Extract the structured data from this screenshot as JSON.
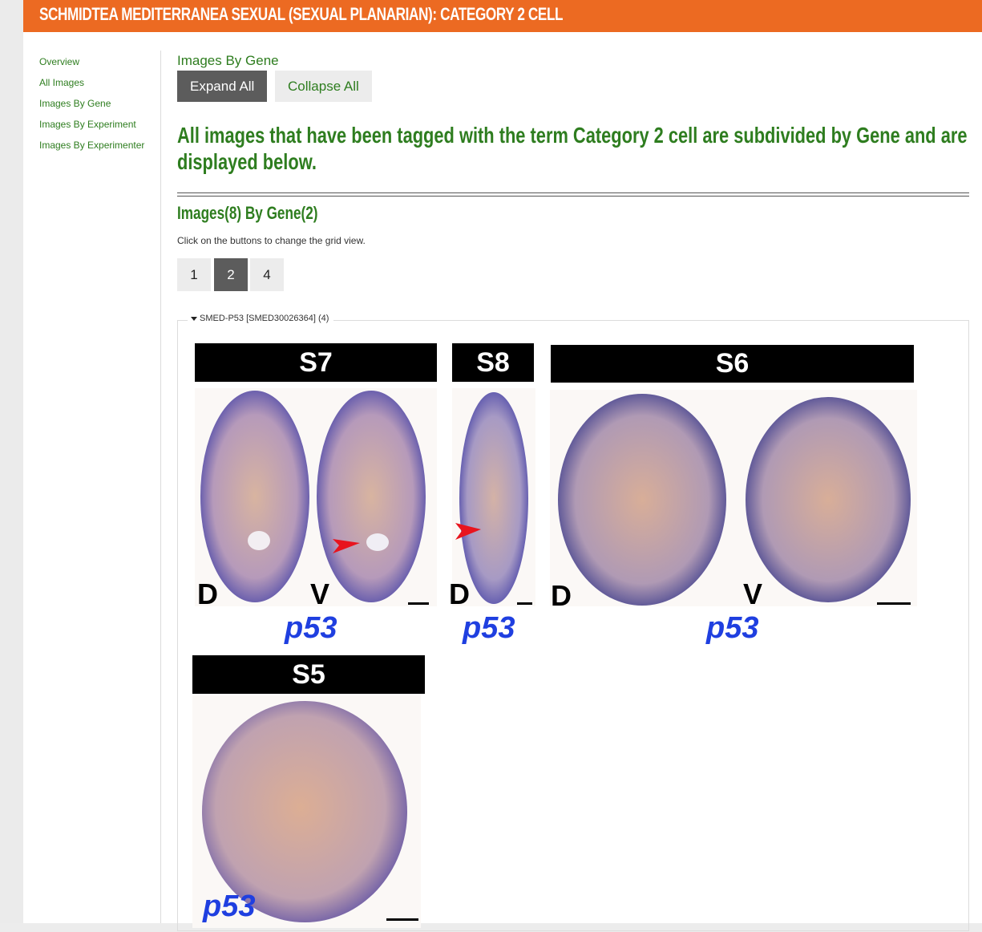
{
  "header": {
    "title": "SCHMIDTEA MEDITERRANEA SEXUAL (SEXUAL PLANARIAN): CATEGORY 2 CELL"
  },
  "sidebar": {
    "items": [
      {
        "label": "Overview"
      },
      {
        "label": "All Images"
      },
      {
        "label": "Images By Gene"
      },
      {
        "label": "Images By Experiment"
      },
      {
        "label": "Images By Experimenter"
      }
    ]
  },
  "main": {
    "section_title": "Images By Gene",
    "expand_label": "Expand All",
    "collapse_label": "Collapse All",
    "intro": "All images that have been tagged with the term Category 2 cell are subdivided by Gene and are displayed below.",
    "count_title": "Images(8) By Gene(2)",
    "hint": "Click on the buttons to change the grid view.",
    "grid_buttons": [
      {
        "label": "1",
        "selected": false
      },
      {
        "label": "2",
        "selected": true
      },
      {
        "label": "4",
        "selected": false
      }
    ],
    "gene_group": {
      "legend": "SMED-P53 [SMED30026364] (4)",
      "images": [
        {
          "stage": "S7",
          "letters": [
            "D",
            "V"
          ],
          "gene": "p53"
        },
        {
          "stage": "S8",
          "letters": [
            "D"
          ],
          "gene": "p53"
        },
        {
          "stage": "S6",
          "letters": [
            "D",
            "V"
          ],
          "gene": "p53"
        },
        {
          "stage": "S5",
          "letters": [],
          "gene": "p53"
        }
      ]
    }
  },
  "colors": {
    "header_bg": "#ec6a22",
    "link_green": "#2e7d1f",
    "button_dark": "#5c5c5c",
    "gene_label_blue": "#1f3fe0",
    "stain_purple": "#3a3aa0",
    "arrowhead_red": "#e8141e"
  }
}
